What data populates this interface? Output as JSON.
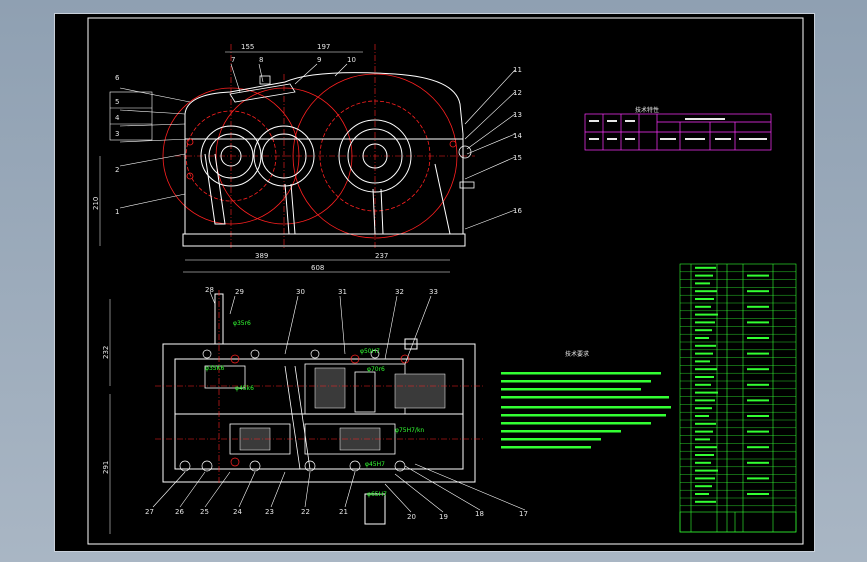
{
  "drawing": {
    "top_dims": [
      "155",
      "197"
    ],
    "left_dims": [
      "210"
    ],
    "bottom_dims": [
      "389",
      "237",
      "608"
    ],
    "plan_dims_left": [
      "232",
      "291"
    ],
    "top_callouts": [
      "7",
      "8",
      "9",
      "10"
    ],
    "left_callouts": [
      "6",
      "5",
      "4",
      "3",
      "2",
      "1"
    ],
    "right_callouts": [
      "11",
      "12",
      "13",
      "14",
      "15",
      "16"
    ],
    "plan_top_callouts": [
      "28",
      "29",
      "30",
      "31",
      "32",
      "33"
    ],
    "plan_bottom_callouts": [
      "27",
      "26",
      "25",
      "24",
      "23",
      "22",
      "21",
      "20",
      "19",
      "18",
      "17"
    ],
    "fits": [
      "φ35r6",
      "φ35K6",
      "φ45k6",
      "φ50H7",
      "φ70r6",
      "φ75H7/kn",
      "φ45H7",
      "φ65H7"
    ]
  },
  "spec_table": {
    "title": "技术特性"
  },
  "tech_req": {
    "title": "技术要求"
  },
  "colors": {
    "outline": "#ffffff",
    "gear": "#ff2020",
    "text": "#33ff33",
    "table": "#ff33ff"
  }
}
